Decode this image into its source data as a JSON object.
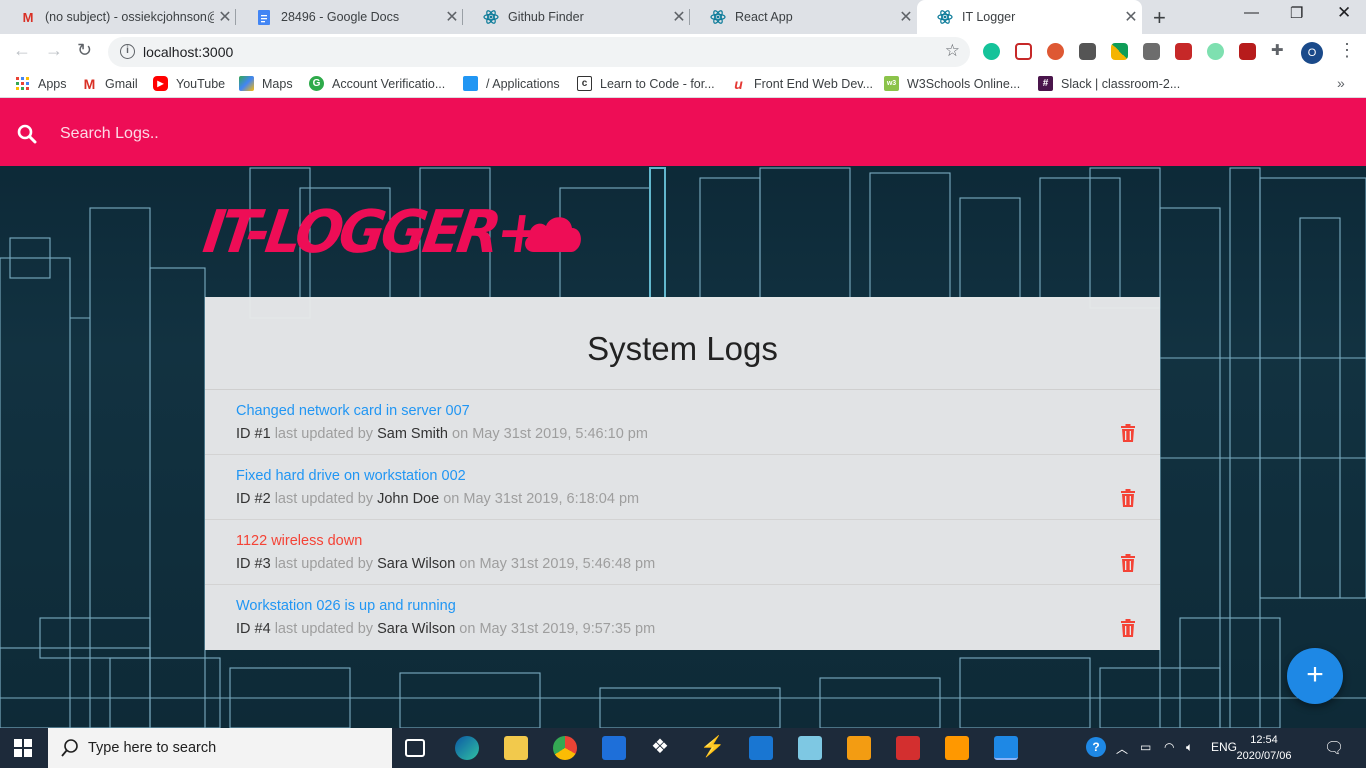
{
  "browser": {
    "tabs": [
      {
        "title": "(no subject) - ossiekcjohnson@",
        "icon": "gmail-icon",
        "color": "#d93025"
      },
      {
        "title": "28496 - Google Docs",
        "icon": "google-docs-icon",
        "color": "#4285f4"
      },
      {
        "title": "Github Finder",
        "icon": "react-icon",
        "color": "#0e7c9a"
      },
      {
        "title": "React App",
        "icon": "react-icon",
        "color": "#0e7c9a"
      },
      {
        "title": "IT Logger",
        "icon": "react-icon",
        "color": "#0e7c9a"
      }
    ],
    "new_tab": "+",
    "url": "localhost:3000",
    "profile_initial": "O",
    "bookmarks": [
      {
        "label": "Apps",
        "icon": "apps-grid-icon"
      },
      {
        "label": "Gmail",
        "icon": "gmail-icon"
      },
      {
        "label": "YouTube",
        "icon": "youtube-icon"
      },
      {
        "label": "Maps",
        "icon": "maps-icon"
      },
      {
        "label": "Account Verificatio...",
        "icon": "account-verification-icon"
      },
      {
        "label": "/ Applications",
        "icon": "folder-icon"
      },
      {
        "label": "Learn to Code - for...",
        "icon": "freecodecamp-icon"
      },
      {
        "label": "Front End Web Dev...",
        "icon": "frontend-icon"
      },
      {
        "label": "W3Schools Online...",
        "icon": "w3schools-icon"
      },
      {
        "label": "Slack | classroom-2...",
        "icon": "slack-icon"
      }
    ]
  },
  "app": {
    "search_placeholder": "Search Logs..",
    "logo_text": "IT-LOGGER+",
    "title": "System Logs",
    "accent": "#ee0d56",
    "logs": [
      {
        "message": "Changed network card in server 007",
        "id": "ID #1",
        "last_updated_by": "last updated by",
        "tech": "Sam Smith",
        "on": "on May 31st 2019, 5:46:10 pm",
        "attention": false
      },
      {
        "message": "Fixed hard drive on workstation 002",
        "id": "ID #2",
        "last_updated_by": "last updated by",
        "tech": "John Doe",
        "on": "on May 31st 2019, 6:18:04 pm",
        "attention": false
      },
      {
        "message": "1122 wireless down",
        "id": "ID #3",
        "last_updated_by": "last updated by",
        "tech": "Sara Wilson",
        "on": "on May 31st 2019, 5:46:48 pm",
        "attention": true
      },
      {
        "message": "Workstation 026 is up and running",
        "id": "ID #4",
        "last_updated_by": "last updated by",
        "tech": "Sara Wilson",
        "on": "on May 31st 2019, 9:57:35 pm",
        "attention": false
      }
    ],
    "fab_label": "+"
  },
  "taskbar": {
    "search_text": "Type here to search",
    "language": "ENG",
    "time": "12:54",
    "date": "2020/07/06"
  }
}
